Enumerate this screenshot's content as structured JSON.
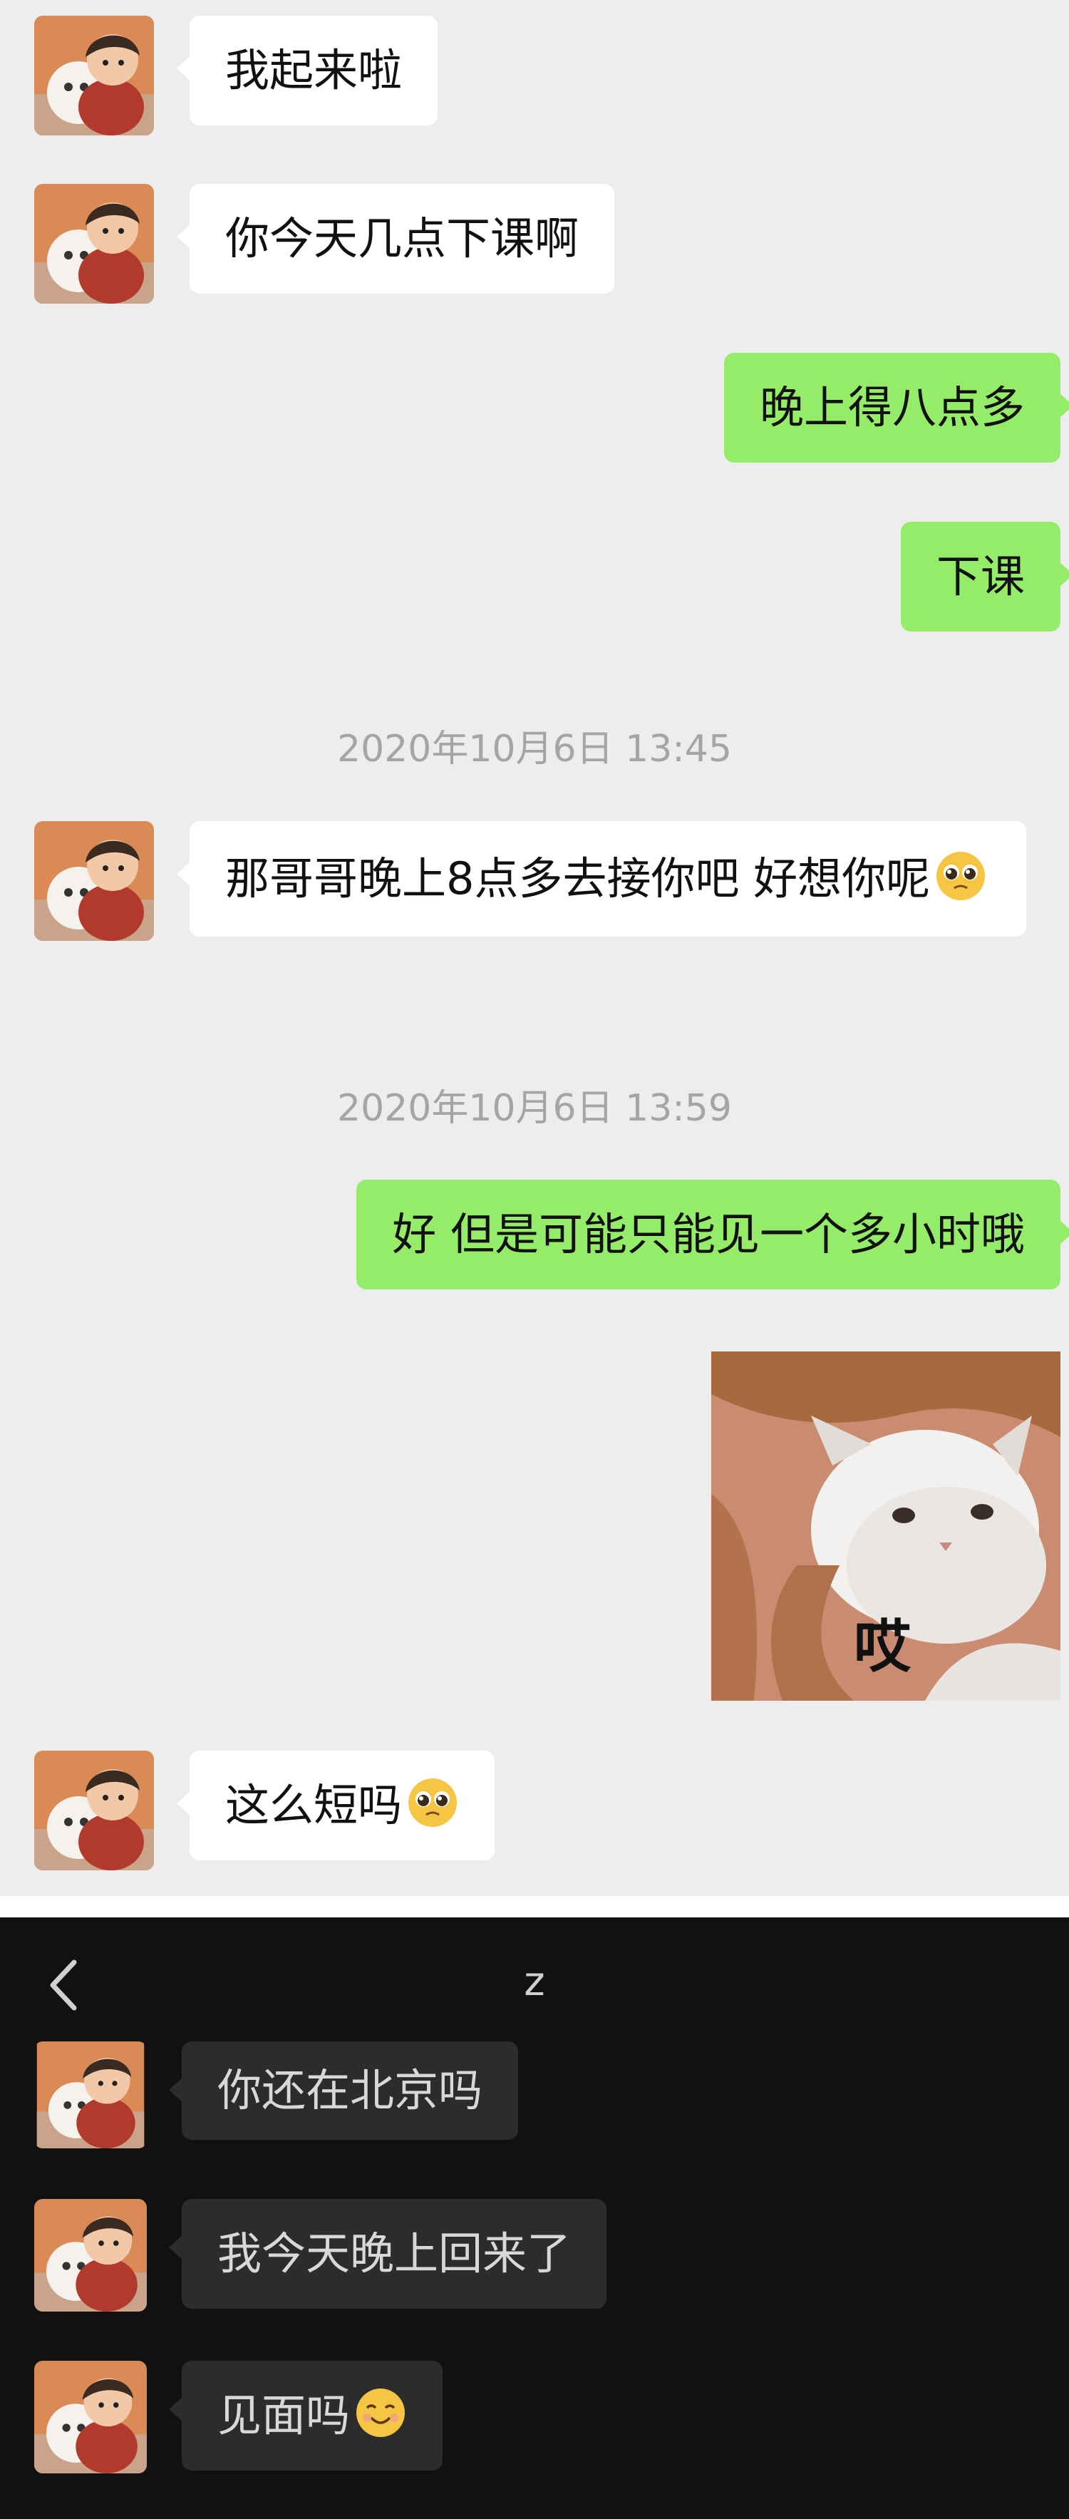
{
  "light_chat": {
    "msg1": "我起来啦",
    "msg2": "你今天几点下课啊",
    "msg3": "晚上得八点多",
    "msg4": "下课",
    "time1": "2020年10月6日 13:45",
    "msg5": "那哥哥晚上8点多去接你吧 好想你呢",
    "time2": "2020年10月6日 13:59",
    "msg6": "好 但是可能只能见一个多小时哦",
    "sticker_text": "哎",
    "msg7": "这么短吗"
  },
  "dark_chat": {
    "title": "z",
    "msg1": "你还在北京吗",
    "msg2": "我今天晚上回来了",
    "msg3": "见面吗"
  },
  "icons": {
    "pleading": "pleading-face-icon",
    "smile": "smiling-face-icon",
    "back": "chevron-left-icon"
  },
  "colors": {
    "outgoing_bubble": "#95ec69",
    "incoming_bubble": "#ffffff",
    "light_bg": "#ededed",
    "dark_bg": "#111111",
    "dark_bubble": "#2c2c2c"
  }
}
